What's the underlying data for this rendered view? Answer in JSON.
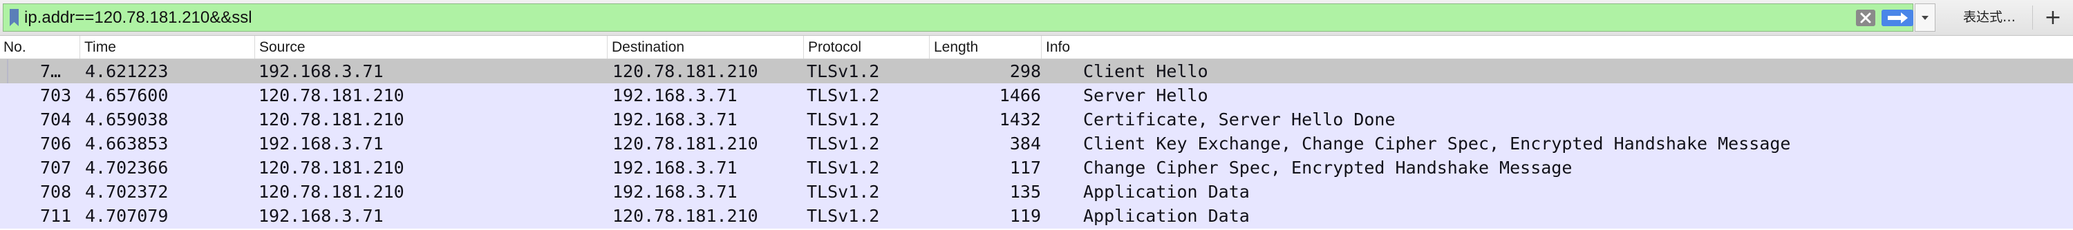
{
  "filter": {
    "value": "ip.addr==120.78.181.210&&ssl",
    "expression_label": "表达式…",
    "add_label": "+",
    "field_color": "#aff2a4"
  },
  "columns": [
    "No.",
    "Time",
    "Source",
    "Destination",
    "Protocol",
    "Length",
    "Info"
  ],
  "rows": [
    {
      "no": "7…",
      "time": "4.621223",
      "src": "192.168.3.71",
      "dst": "120.78.181.210",
      "proto": "TLSv1.2",
      "len": "298",
      "info": "Client Hello",
      "selected": true
    },
    {
      "no": "703",
      "time": "4.657600",
      "src": "120.78.181.210",
      "dst": "192.168.3.71",
      "proto": "TLSv1.2",
      "len": "1466",
      "info": "Server Hello"
    },
    {
      "no": "704",
      "time": "4.659038",
      "src": "120.78.181.210",
      "dst": "192.168.3.71",
      "proto": "TLSv1.2",
      "len": "1432",
      "info": "Certificate, Server Hello Done"
    },
    {
      "no": "706",
      "time": "4.663853",
      "src": "192.168.3.71",
      "dst": "120.78.181.210",
      "proto": "TLSv1.2",
      "len": "384",
      "info": "Client Key Exchange, Change Cipher Spec, Encrypted Handshake Message"
    },
    {
      "no": "707",
      "time": "4.702366",
      "src": "120.78.181.210",
      "dst": "192.168.3.71",
      "proto": "TLSv1.2",
      "len": "117",
      "info": "Change Cipher Spec, Encrypted Handshake Message"
    },
    {
      "no": "708",
      "time": "4.702372",
      "src": "120.78.181.210",
      "dst": "192.168.3.71",
      "proto": "TLSv1.2",
      "len": "135",
      "info": "Application Data"
    },
    {
      "no": "711",
      "time": "4.707079",
      "src": "192.168.3.71",
      "dst": "120.78.181.210",
      "proto": "TLSv1.2",
      "len": "119",
      "info": "Application Data"
    }
  ],
  "colors": {
    "row_tls": "#e7e6ff",
    "row_selected": "#c6c6c6"
  }
}
